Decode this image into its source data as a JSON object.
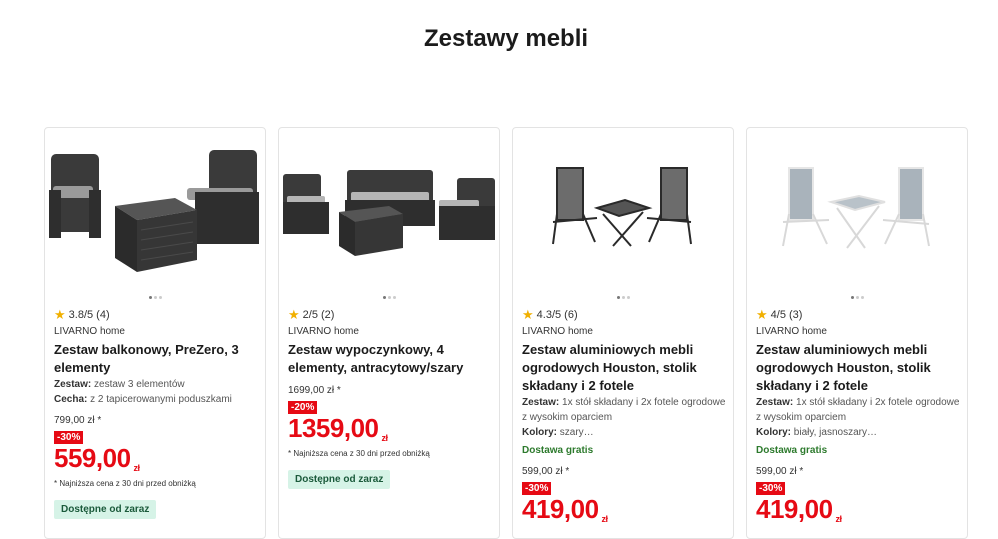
{
  "page": {
    "title": "Zestawy mebli"
  },
  "products": [
    {
      "rating": "3.8/5 (4)",
      "brand": "LIVARNO home",
      "name": "Zestaw balkonowy, PreZero, 3 elementy",
      "attr1_label": "Zestaw:",
      "attr1_value": "zestaw 3 elementów",
      "attr2_label": "Cecha:",
      "attr2_value": "z 2 tapicerowanymi poduszkami",
      "old_price": "799,00 zł *",
      "discount": "-30%",
      "price": "559,00",
      "currency": "zł",
      "note": "* Najniższa cena z 30 dni przed obniżką",
      "availability": "Dostępne od zaraz"
    },
    {
      "rating": "2/5 (2)",
      "brand": "LIVARNO home",
      "name": "Zestaw wypoczynkowy, 4 elementy, antracytowy/szary",
      "old_price": "1699,00 zł *",
      "discount": "-20%",
      "price": "1359,00",
      "currency": "zł",
      "note": "* Najniższa cena z 30 dni przed obniżką",
      "availability": "Dostępne od zaraz"
    },
    {
      "rating": "4.3/5 (6)",
      "brand": "LIVARNO home",
      "name": "Zestaw aluminiowych mebli ogrodowych Houston, stolik składany i 2 fotele",
      "attr1_label": "Zestaw:",
      "attr1_value": "1x stół składany i 2x fotele ogrodowe z wysokim oparciem",
      "attr2_label": "Kolory:",
      "attr2_value": "szary…",
      "delivery": "Dostawa gratis",
      "old_price": "599,00 zł *",
      "discount": "-30%",
      "price": "419,00",
      "currency": "zł"
    },
    {
      "rating": "4/5 (3)",
      "brand": "LIVARNO home",
      "name": "Zestaw aluminiowych mebli ogrodowych Houston, stolik składany i 2 fotele",
      "attr1_label": "Zestaw:",
      "attr1_value": "1x stół składany i 2x fotele ogrodowe z wysokim oparciem",
      "attr2_label": "Kolory:",
      "attr2_value": "biały, jasnoszary…",
      "delivery": "Dostawa gratis",
      "old_price": "599,00 zł *",
      "discount": "-30%",
      "price": "419,00",
      "currency": "zł"
    }
  ],
  "colors": {
    "price_red": "#e60a14",
    "availability_bg": "#d6f3e7",
    "delivery_green": "#2d7a2d",
    "star": "#f1b000"
  }
}
